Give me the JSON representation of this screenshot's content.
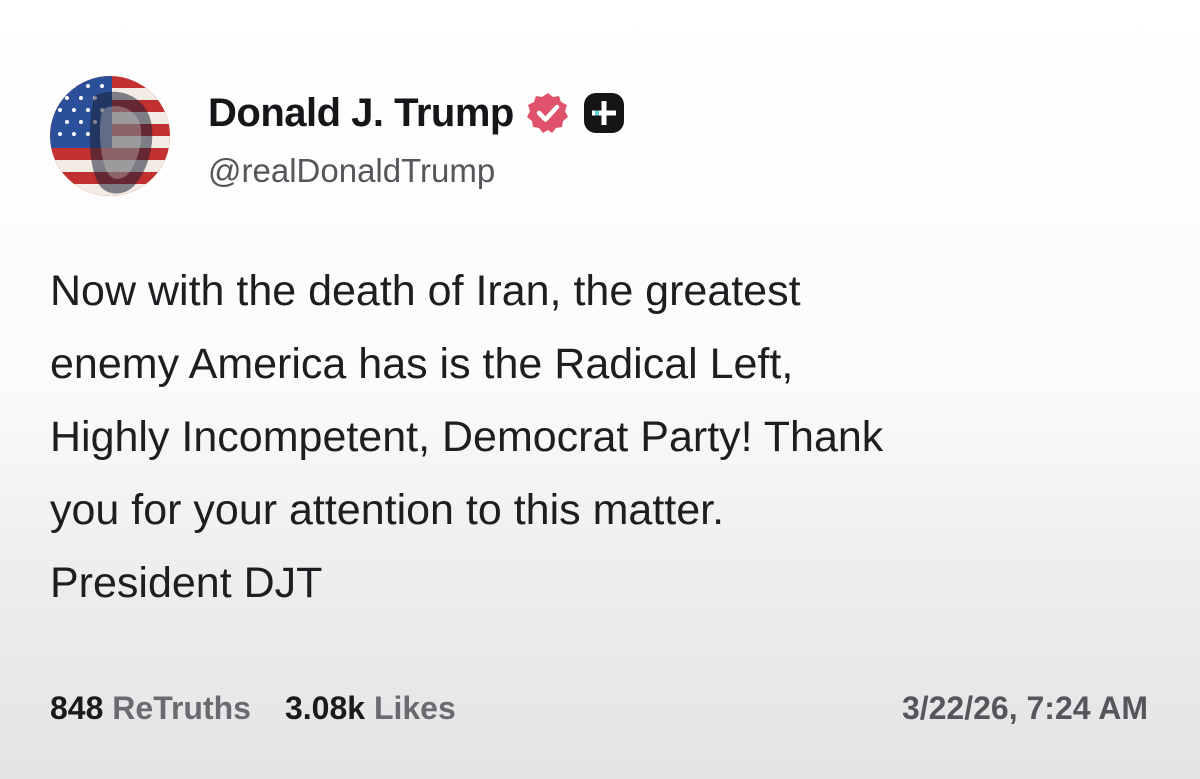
{
  "post": {
    "author": {
      "name": "Donald J. Trump",
      "handle": "@realDonaldTrump",
      "avatar_icon": "profile-photo-flag",
      "verified_icon": "verified-badge-icon",
      "verified_color": "#e0526b",
      "extra_icon": "plus-badge-icon"
    },
    "body_lines": [
      "Now with the death of Iran, the greatest",
      "enemy America has is the Radical Left,",
      "Highly Incompetent, Democrat Party! Thank",
      "you for your attention to this matter.",
      "President DJT"
    ],
    "stats": {
      "retruths_count": "848",
      "retruths_label": "ReTruths",
      "likes_count": "3.08k",
      "likes_label": "Likes"
    },
    "timestamp": "3/22/26, 7:24 AM"
  }
}
